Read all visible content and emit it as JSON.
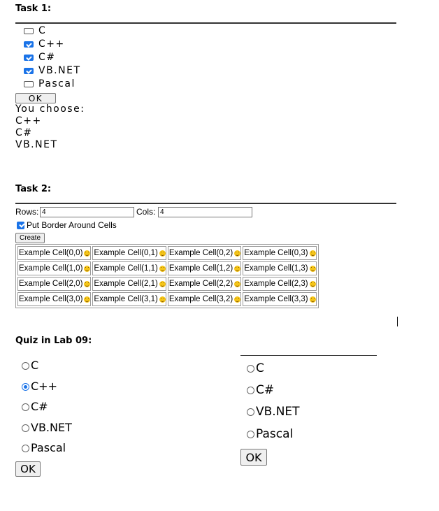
{
  "task1": {
    "heading": "Task 1:",
    "options": [
      {
        "label": "C",
        "checked": false
      },
      {
        "label": "C++",
        "checked": true
      },
      {
        "label": "C#",
        "checked": true
      },
      {
        "label": "VB.NET",
        "checked": true
      },
      {
        "label": "Pascal",
        "checked": false
      }
    ],
    "ok_label": "OK",
    "result_heading": "You choose:",
    "results": [
      "C++",
      "C#",
      "VB.NET"
    ]
  },
  "task2": {
    "heading": "Task 2:",
    "rows_label": "Rows:",
    "rows_value": "4",
    "cols_label": "Cols:",
    "cols_value": "4",
    "border_label": "Put Border Around Cells",
    "border_checked": true,
    "create_label": "Create",
    "cells": [
      [
        "Example Cell(0,0)",
        "Example Cell(0,1)",
        "Example Cell(0,2)",
        "Example Cell(0,3)"
      ],
      [
        "Example Cell(1,0)",
        "Example Cell(1,1)",
        "Example Cell(1,2)",
        "Example Cell(1,3)"
      ],
      [
        "Example Cell(2,0)",
        "Example Cell(2,1)",
        "Example Cell(2,2)",
        "Example Cell(2,3)"
      ],
      [
        "Example Cell(3,0)",
        "Example Cell(3,1)",
        "Example Cell(3,2)",
        "Example Cell(3,3)"
      ]
    ],
    "cell_icon": "smiley-icon"
  },
  "quiz": {
    "heading": "Quiz in Lab 09:",
    "left_options": [
      {
        "label": "C",
        "selected": false
      },
      {
        "label": "C++",
        "selected": true
      },
      {
        "label": "C#",
        "selected": false
      },
      {
        "label": "VB.NET",
        "selected": false
      },
      {
        "label": "Pascal",
        "selected": false
      }
    ],
    "left_ok_label": "OK",
    "right_options": [
      {
        "label": "C",
        "selected": false
      },
      {
        "label": "C#",
        "selected": false
      },
      {
        "label": "VB.NET",
        "selected": false
      },
      {
        "label": "Pascal",
        "selected": false
      }
    ],
    "right_ok_label": "OK"
  },
  "colors": {
    "accent": "#1a73e8",
    "smiley": "#f5c518"
  }
}
